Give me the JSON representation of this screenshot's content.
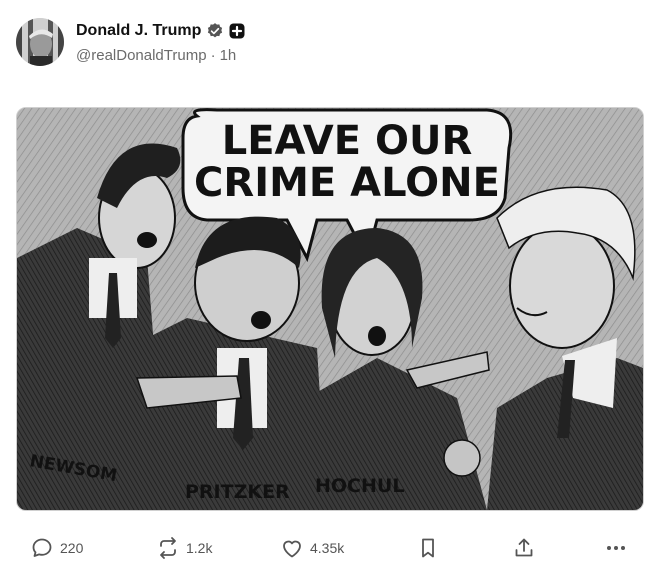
{
  "post": {
    "author": {
      "display_name": "Donald J. Trump",
      "handle": "@realDonaldTrump",
      "separator": "·",
      "time": "1h",
      "badges": [
        "verified-badge-icon",
        "plus-badge-icon"
      ]
    },
    "image": {
      "speech_bubble": [
        "LEAVE OUR",
        "CRIME ALONE"
      ],
      "labels": [
        "NEWSOM",
        "PRITZKER",
        "HOCHUL"
      ]
    },
    "actions": {
      "reply_count": "220",
      "repost_count": "1.2k",
      "like_count": "4.35k",
      "icons": [
        "reply-icon",
        "repost-icon",
        "like-icon",
        "bookmark-icon",
        "share-icon",
        "more-icon"
      ]
    }
  },
  "colors": {
    "text": "#111111",
    "muted": "#6b6b6b",
    "icon": "#555555",
    "badge": "#555555"
  }
}
